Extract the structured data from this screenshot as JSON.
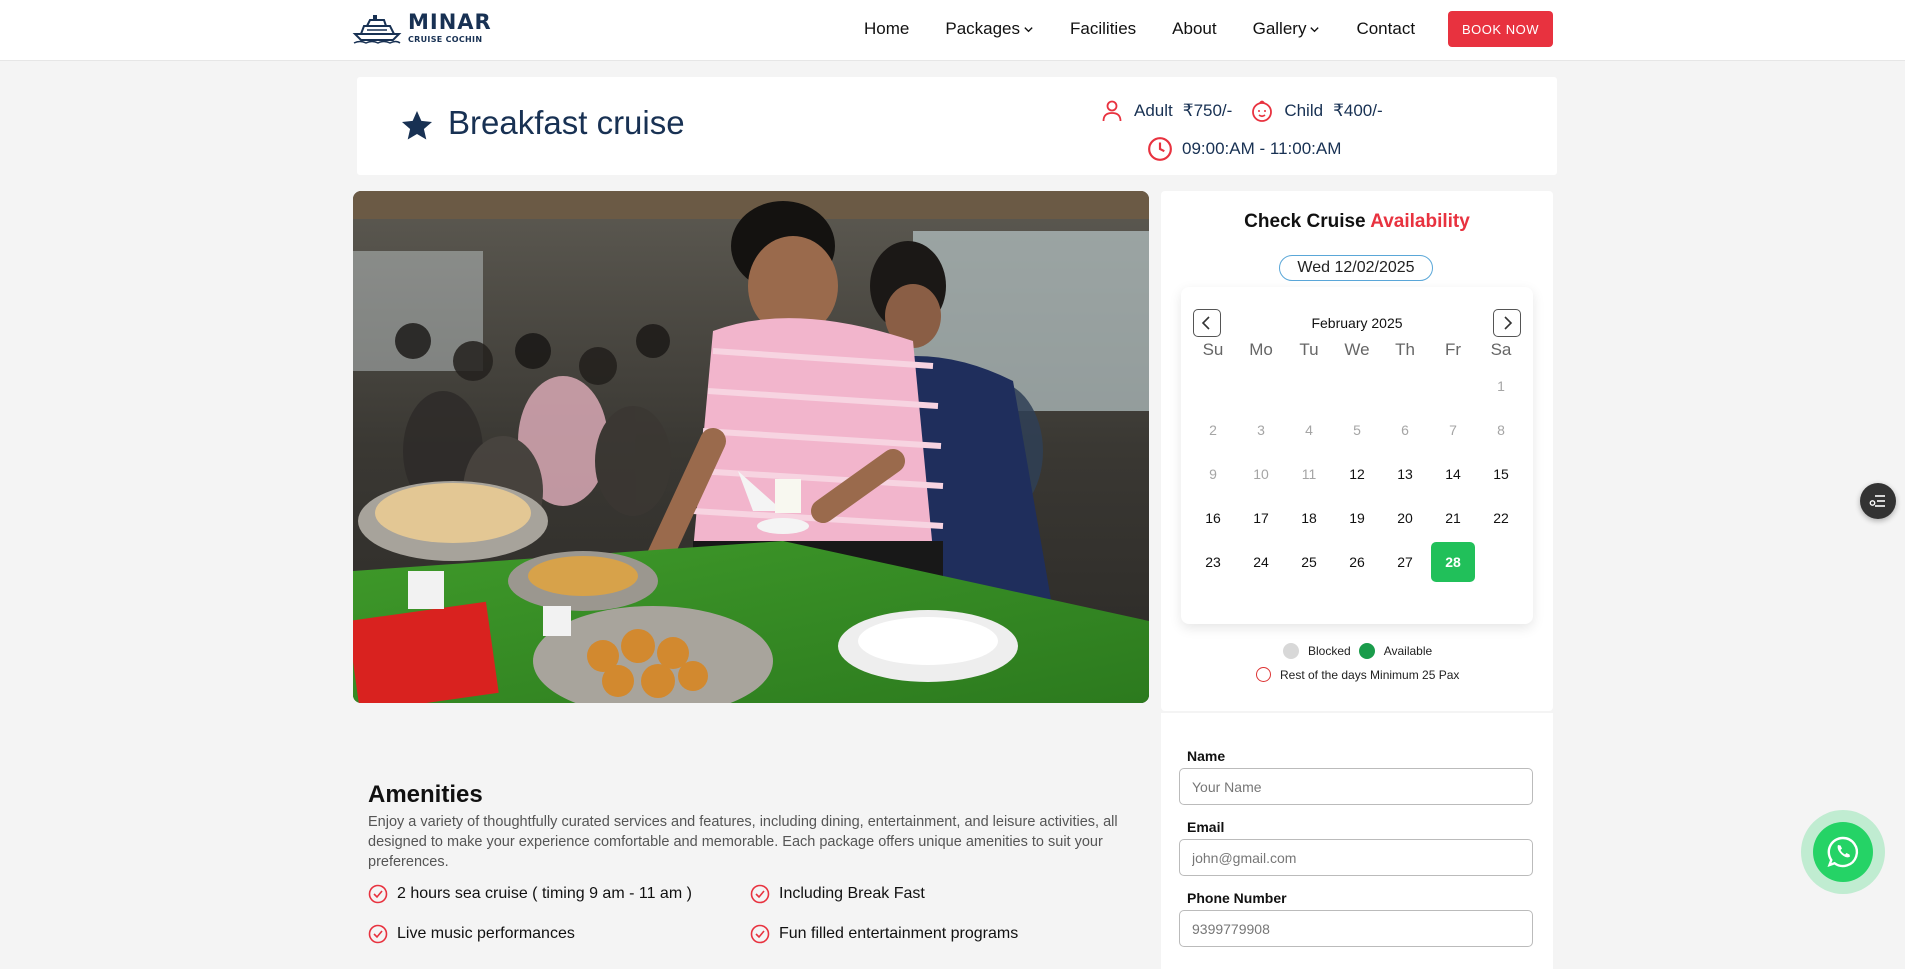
{
  "brand": {
    "name": "MINAR",
    "tagline": "CRUISE COCHIN"
  },
  "nav": {
    "home": "Home",
    "packages": "Packages",
    "facilities": "Facilities",
    "about": "About",
    "gallery": "Gallery",
    "contact": "Contact",
    "book_now": "BOOK NOW"
  },
  "cruise": {
    "title": "Breakfast cruise",
    "adult_label": "Adult",
    "adult_price": "₹750/-",
    "child_label": "Child",
    "child_price": "₹400/-",
    "timing": "09:00:AM - 11:00:AM"
  },
  "availability": {
    "title_part1": "Check Cruise",
    "title_part2": "Availability",
    "selected_date": "Wed 12/02/2025",
    "month": "February 2025",
    "weekdays": [
      "Su",
      "Mo",
      "Tu",
      "We",
      "Th",
      "Fr",
      "Sa"
    ],
    "first_weekday_index": 6,
    "days_in_month": 28,
    "first_enabled_day": 12,
    "selected_day": 28,
    "legend_blocked": "Blocked",
    "legend_available": "Available",
    "legend_rest": "Rest of the days Minimum 25 Pax"
  },
  "form": {
    "name_label": "Name",
    "name_placeholder": "Your Name",
    "email_label": "Email",
    "email_placeholder": "john@gmail.com",
    "phone_label": "Phone Number",
    "phone_placeholder": "9399779908"
  },
  "amenities": {
    "title": "Amenities",
    "description": "Enjoy a variety of thoughtfully curated services and features, including dining, entertainment, and leisure activities, all designed to make your experience comfortable and memorable. Each package offers unique amenities to suit your preferences.",
    "items": [
      "2 hours sea cruise ( timing 9 am - 11 am )",
      "Including Break Fast",
      "Live music performances",
      "Fun filled entertainment programs"
    ]
  },
  "colors": {
    "brand_navy": "#183153",
    "accent_red": "#e8323f",
    "available_green": "#21c05a",
    "whatsapp_green": "#25d366"
  }
}
